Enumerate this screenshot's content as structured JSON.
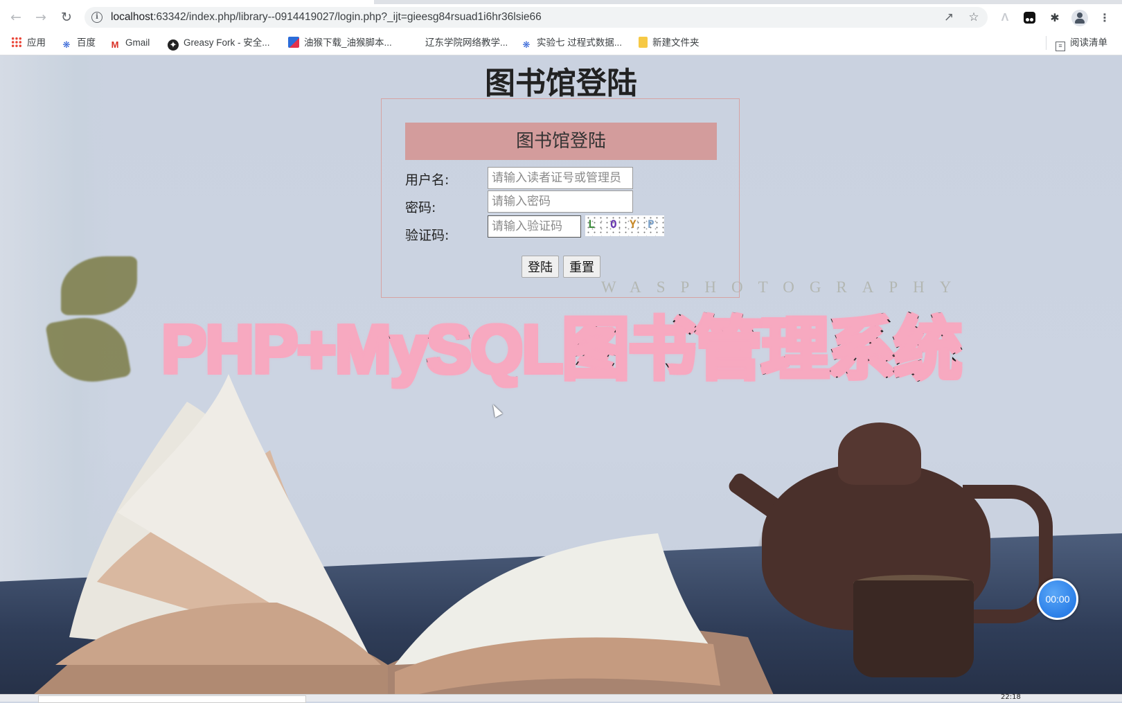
{
  "browser": {
    "url_host": "localhost",
    "url_rest": ":63342/index.php/library--0914419027/login.php?_ijt=gieesg84rsuad1i6hr36lsie66",
    "nav": {
      "back": "back-arrow",
      "forward": "forward-arrow",
      "reload": "reload"
    },
    "bookmarks": [
      {
        "label": "应用",
        "icon": "apps-grid"
      },
      {
        "label": "百度",
        "icon": "baidu-paw"
      },
      {
        "label": "Gmail",
        "icon": "gmail"
      },
      {
        "label": "Greasy Fork - 安全...",
        "icon": "greasy-fork"
      },
      {
        "label": "油猴下载_油猴脚本...",
        "icon": "tampermonkey"
      },
      {
        "label": "辽东学院网络教学...",
        "icon": "none"
      },
      {
        "label": "实验七 过程式数据...",
        "icon": "baidu-paw"
      },
      {
        "label": "新建文件夹",
        "icon": "folder"
      }
    ],
    "reading_list": "阅读清单"
  },
  "page": {
    "title": "图书馆登陆",
    "login": {
      "header": "图书馆登陆",
      "username_label": "用户名:",
      "username_placeholder": "请输入读者证号或管理员",
      "password_label": "密码:",
      "password_placeholder": "请输入密码",
      "captcha_label": "验证码:",
      "captcha_placeholder": "请输入验证码",
      "captcha_chars": [
        "L",
        "O",
        "Y",
        "P"
      ],
      "captcha_colors": [
        "#3a8a3a",
        "#6a3bb0",
        "#c88a2a",
        "#7aa0c8"
      ],
      "login_button": "登陆",
      "reset_button": "重置"
    },
    "watermark": "WASPHOTOGRAPHY",
    "banner": "PHP+MySQL图书管理系统",
    "timer": "00:00"
  },
  "taskbar": {
    "clock": "22:18"
  }
}
